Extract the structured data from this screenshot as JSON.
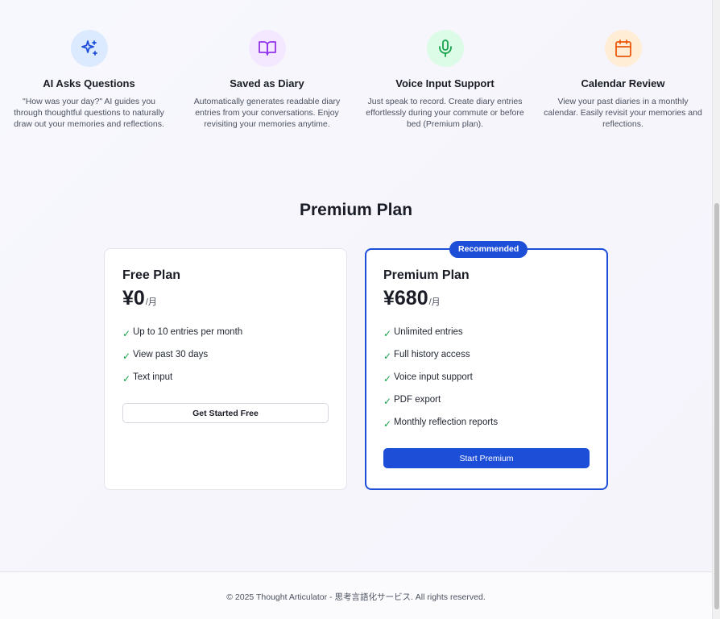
{
  "features": [
    {
      "icon": "sparkles-icon",
      "icon_color": "#1d4ed8",
      "icon_bg": "#dbeafe",
      "title": "AI Asks Questions",
      "description": "\"How was your day?\" AI guides you through thoughtful questions to naturally draw out your memories and reflections."
    },
    {
      "icon": "book-open-icon",
      "icon_color": "#9333ea",
      "icon_bg": "#f3e8ff",
      "title": "Saved as Diary",
      "description": "Automatically generates readable diary entries from your conversations. Enjoy revisiting your memories anytime."
    },
    {
      "icon": "microphone-icon",
      "icon_color": "#16a34a",
      "icon_bg": "#dcfce7",
      "title": "Voice Input Support",
      "description": "Just speak to record. Create diary entries effortlessly during your commute or before bed (Premium plan)."
    },
    {
      "icon": "calendar-icon",
      "icon_color": "#ea580c",
      "icon_bg": "#ffedd5",
      "title": "Calendar Review",
      "description": "View your past diaries in a monthly calendar. Easily revisit your memories and reflections."
    }
  ],
  "pricing": {
    "title": "Premium Plan",
    "free": {
      "name": "Free Plan",
      "price": "¥0",
      "unit": "/月",
      "features": [
        "Up to 10 entries per month",
        "View past 30 days",
        "Text input"
      ],
      "cta": "Get Started Free"
    },
    "premium": {
      "badge": "Recommended",
      "name": "Premium Plan",
      "price": "¥680",
      "unit": "/月",
      "features": [
        "Unlimited entries",
        "Full history access",
        "Voice input support",
        "PDF export",
        "Monthly reflection reports"
      ],
      "cta": "Start Premium"
    },
    "check_symbol": "✓"
  },
  "footer": {
    "text": "© 2025 Thought Articulator - 思考言語化サービス. All rights reserved."
  },
  "colors": {
    "accent": "#1d4ed8",
    "check": "#16a34a"
  }
}
